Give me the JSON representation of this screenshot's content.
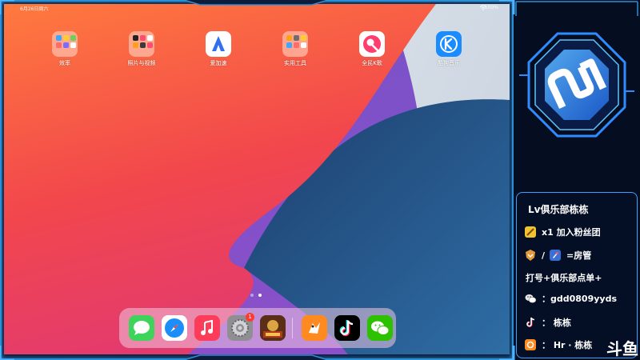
{
  "status_bar": {
    "time": "6月26日周六",
    "battery": "100%"
  },
  "home_apps": [
    {
      "id": "efficiency",
      "label": "效率",
      "kind": "folder"
    },
    {
      "id": "photo-video",
      "label": "照片与视频",
      "kind": "folder"
    },
    {
      "id": "aijiasu",
      "label": "爱加速",
      "kind": "app"
    },
    {
      "id": "utilities",
      "label": "实用工具",
      "kind": "folder"
    },
    {
      "id": "quanmin-k",
      "label": "全民K歌",
      "kind": "app"
    },
    {
      "id": "kugou",
      "label": "酷狗音乐",
      "kind": "app"
    }
  ],
  "dock": {
    "apps": [
      "messages",
      "safari",
      "music",
      "settings",
      "game",
      "kuaishou-game",
      "tiktok",
      "wechat"
    ],
    "settings_badge": "1"
  },
  "panel": {
    "title": "Lv俱乐部栋栋",
    "line_fan": "x1 加入粉丝团",
    "line_admin_sep": "/",
    "line_admin": "=房管",
    "line_order": "打号+俱乐部点单+",
    "line_wechat": "：gdd0809yyds",
    "line_douyin": "： 栋栋",
    "line_hr": "： Hr · 栋栋",
    "watermark": "斗鱼"
  },
  "colors": {
    "accent_blue": "#38a3ff",
    "panel_bg": "#050d20"
  }
}
